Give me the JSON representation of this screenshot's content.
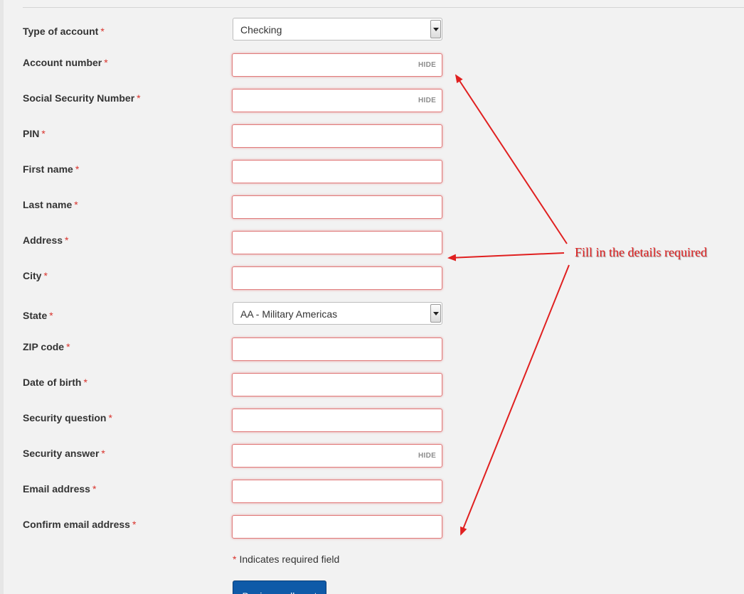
{
  "form": {
    "required_marker": "*",
    "fields": [
      {
        "label": "Type of account",
        "kind": "select",
        "value": "Checking"
      },
      {
        "label": "Account number",
        "kind": "input",
        "value": "",
        "toggle": "HIDE"
      },
      {
        "label": "Social Security Number",
        "kind": "input",
        "value": "",
        "toggle": "HIDE"
      },
      {
        "label": "PIN",
        "kind": "input",
        "value": ""
      },
      {
        "label": "First name",
        "kind": "input",
        "value": ""
      },
      {
        "label": "Last name",
        "kind": "input",
        "value": ""
      },
      {
        "label": "Address",
        "kind": "input",
        "value": ""
      },
      {
        "label": "City",
        "kind": "input",
        "value": ""
      },
      {
        "label": "State",
        "kind": "select",
        "value": "AA - Military Americas"
      },
      {
        "label": "ZIP code",
        "kind": "input",
        "value": ""
      },
      {
        "label": "Date of birth",
        "kind": "input",
        "value": ""
      },
      {
        "label": "Security question",
        "kind": "input",
        "value": ""
      },
      {
        "label": "Security answer",
        "kind": "input",
        "value": "",
        "toggle": "HIDE"
      },
      {
        "label": "Email address",
        "kind": "input",
        "value": ""
      },
      {
        "label": "Confirm email address",
        "kind": "input",
        "value": ""
      }
    ],
    "required_note": "Indicates required field",
    "submit_label": "Begin enrollment"
  },
  "annotation": {
    "text": "Fill in the details required",
    "color": "#e02020"
  },
  "colors": {
    "required": "#d9322b",
    "input_error_border": "#e07b7b",
    "button_bg": "#0f5aa8"
  }
}
